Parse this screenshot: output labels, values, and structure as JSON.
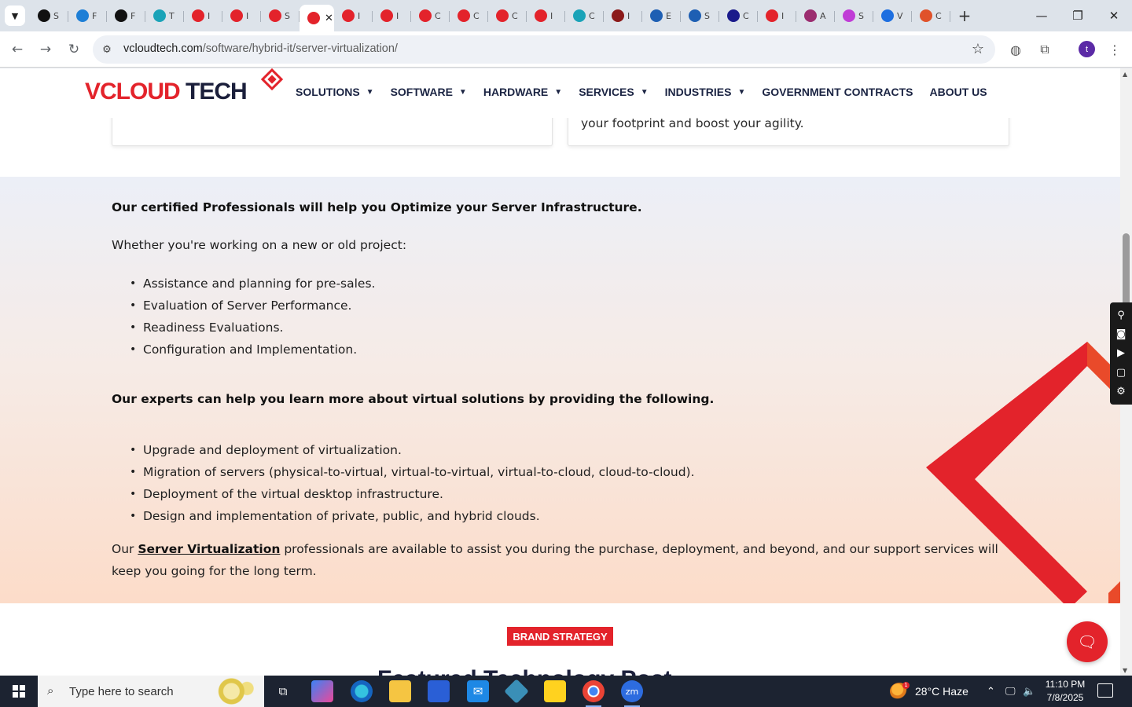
{
  "browser": {
    "tabs": [
      {
        "label": "S",
        "color": "#111111"
      },
      {
        "label": "F",
        "color": "#1e7fd6"
      },
      {
        "label": "F",
        "color": "#111111"
      },
      {
        "label": "T",
        "color": "#1aa3b8"
      },
      {
        "label": "I",
        "color": "#e3232b"
      },
      {
        "label": "I",
        "color": "#e3232b"
      },
      {
        "label": "S",
        "color": "#e3232b"
      },
      {
        "label": "S",
        "color": "#e3232b",
        "active": true
      },
      {
        "label": "I",
        "color": "#e3232b"
      },
      {
        "label": "I",
        "color": "#e3232b"
      },
      {
        "label": "C",
        "color": "#e3232b"
      },
      {
        "label": "C",
        "color": "#e3232b"
      },
      {
        "label": "C",
        "color": "#e3232b"
      },
      {
        "label": "I",
        "color": "#e3232b"
      },
      {
        "label": "C",
        "color": "#1aa3b8"
      },
      {
        "label": "I",
        "color": "#8b1a1a"
      },
      {
        "label": "E",
        "color": "#1e5fb3"
      },
      {
        "label": "S",
        "color": "#1e5fb3"
      },
      {
        "label": "C",
        "color": "#1a1a8b"
      },
      {
        "label": "I",
        "color": "#e3232b"
      },
      {
        "label": "A",
        "color": "#9b2d6f"
      },
      {
        "label": "S",
        "color": "#c03cd6"
      },
      {
        "label": "V",
        "color": "#1e6fe0"
      },
      {
        "label": "C",
        "color": "#e0522a"
      }
    ],
    "url_host": "vcloudtech.com",
    "url_path": "/software/hybrid-it/server-virtualization/",
    "profile_initial": "t"
  },
  "site": {
    "logo_v": "V",
    "logo_cloud": "CLOUD",
    "logo_tech": " TECH",
    "nav": [
      {
        "label": "SOLUTIONS",
        "dropdown": true
      },
      {
        "label": "SOFTWARE",
        "dropdown": true
      },
      {
        "label": "HARDWARE",
        "dropdown": true
      },
      {
        "label": "SERVICES",
        "dropdown": true
      },
      {
        "label": "INDUSTRIES",
        "dropdown": true
      },
      {
        "label": "GOVERNMENT CONTRACTS",
        "dropdown": false
      },
      {
        "label": "ABOUT US",
        "dropdown": false
      }
    ]
  },
  "content": {
    "card_right_tail": "your footprint and boost your agility.",
    "heading1": "Our certified Professionals will help you Optimize your Server Infrastructure.",
    "intro1": "Whether you're working on a new or old project:",
    "list1": [
      "Assistance and planning for pre-sales.",
      "Evaluation of Server Performance.",
      "Readiness Evaluations.",
      "Configuration and Implementation."
    ],
    "heading2": "Our experts can help you learn more about virtual solutions by providing the following.",
    "list2": [
      "Upgrade and deployment of virtualization.",
      "Migration of servers (physical-to-virtual, virtual-to-virtual, virtual-to-cloud, cloud-to-cloud).",
      "Deployment of the virtual desktop infrastructure.",
      "Design and implementation of private, public, and hybrid clouds."
    ],
    "para_prefix": "Our ",
    "para_link": "Server Virtualization",
    "para_suffix": " professionals are available to assist you during the purchase, deployment, and beyond, and our support services will keep you going for the long term.",
    "badge": "BRAND STRATEGY",
    "next_heading": "Featured Technology Post"
  },
  "taskbar": {
    "search_placeholder": "Type here to search",
    "weather": "28°C  Haze",
    "weather_badge": "1",
    "time": "11:10 PM",
    "date": "7/8/2025"
  },
  "colors": {
    "brand_red": "#e3232b",
    "brand_navy": "#1b1f3b"
  }
}
